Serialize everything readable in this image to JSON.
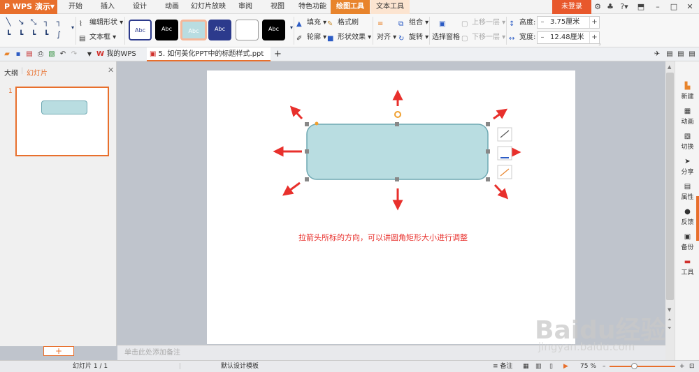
{
  "app": {
    "name": "WPS 演示"
  },
  "menu_tabs": [
    "开始",
    "插入",
    "设计",
    "动画",
    "幻灯片放映",
    "审阅",
    "视图",
    "特色功能",
    "绘图工具",
    "文本工具"
  ],
  "login_label": "未登录",
  "ribbon": {
    "edit_shape": "编辑形状",
    "text_box": "文本框",
    "style_label": "Abc",
    "fill": "填充",
    "format_painter": "格式刷",
    "outline": "轮廓",
    "shape_effect": "形状效果",
    "align": "对齐",
    "group": "组合",
    "rotate": "旋转",
    "selection_pane": "选择窗格",
    "bring_forward": "上移一层",
    "send_backward": "下移一层",
    "height_label": "高度:",
    "height_value": "3.75厘米",
    "width_label": "宽度:",
    "width_value": "12.48厘米"
  },
  "tabs": {
    "my_wps": "我的WPS",
    "doc_title": "5. 如何美化PPT中的标题样式.ppt *",
    "new_tab": "+"
  },
  "left_panel": {
    "outline_tab": "大纲",
    "slides_tab": "幻灯片",
    "slide_number": "1",
    "add_label": "+"
  },
  "slide": {
    "annotation": "拉箭头所标的方向，可以讲圆角矩形大小进行调整"
  },
  "notes_placeholder": "单击此处添加备注",
  "right_sidebar": [
    "新建",
    "动画",
    "切换",
    "分享",
    "属性",
    "反馈",
    "备份",
    "工具"
  ],
  "status": {
    "slide_info": "幻灯片 1 / 1",
    "template": "默认设计模板",
    "notes": "备注",
    "zoom": "75 %"
  },
  "watermark": {
    "brand": "Baidu经验",
    "url": "jingyan.baidu.com"
  },
  "colors": {
    "accent": "#e8842c",
    "shape_fill": "#b9dde1",
    "shape_border": "#6fa9b3",
    "arrow": "#e8302c",
    "annotation": "#e8302c"
  }
}
